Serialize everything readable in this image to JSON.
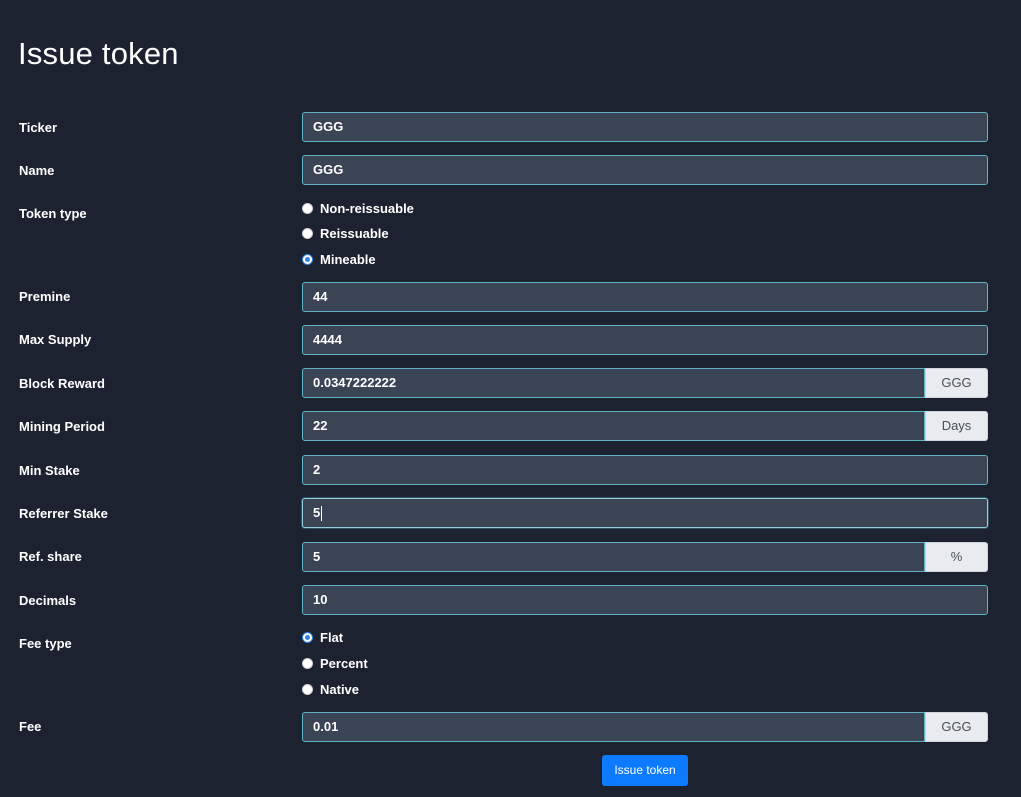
{
  "page_title": "Issue token",
  "fields": {
    "ticker": {
      "label": "Ticker",
      "value": "GGG"
    },
    "name": {
      "label": "Name",
      "value": "GGG"
    },
    "token_type": {
      "label": "Token type",
      "options": [
        "Non-reissuable",
        "Reissuable",
        "Mineable"
      ],
      "selected": "Mineable"
    },
    "premine": {
      "label": "Premine",
      "value": "44"
    },
    "max_supply": {
      "label": "Max Supply",
      "value": "4444"
    },
    "block_reward": {
      "label": "Block Reward",
      "value": "0.0347222222",
      "addon": "GGG"
    },
    "mining_period": {
      "label": "Mining Period",
      "value": "22",
      "addon": "Days"
    },
    "min_stake": {
      "label": "Min Stake",
      "value": "2"
    },
    "referrer_stake": {
      "label": "Referrer Stake",
      "value": "5"
    },
    "ref_share": {
      "label": "Ref. share",
      "value": "5",
      "addon": "%"
    },
    "decimals": {
      "label": "Decimals",
      "value": "10"
    },
    "fee_type": {
      "label": "Fee type",
      "options": [
        "Flat",
        "Percent",
        "Native"
      ],
      "selected": "Flat"
    },
    "fee": {
      "label": "Fee",
      "value": "0.01",
      "addon": "GGG"
    }
  },
  "submit_label": "Issue token",
  "colors": {
    "background": "#1c2230",
    "input_bg": "#3b4455",
    "input_border": "#5fb3c4",
    "button": "#0d7bff",
    "radio_checked": "#2f84e8"
  }
}
